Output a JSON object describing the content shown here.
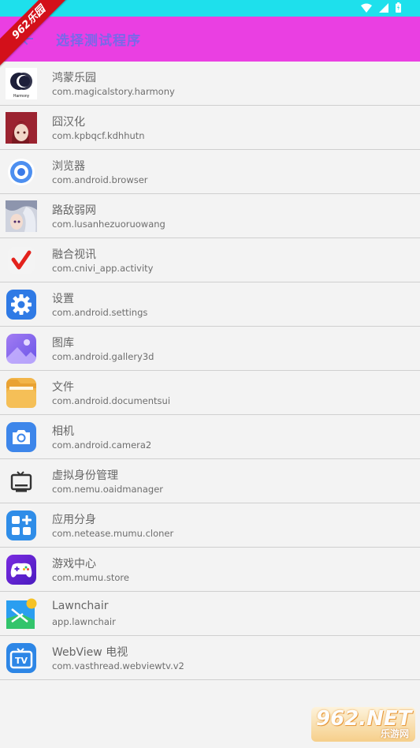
{
  "app_bar": {
    "title": "选择测试程序"
  },
  "ribbon": {
    "text": "962乐园"
  },
  "watermark": {
    "big": "962.NET",
    "small": "乐游网"
  },
  "apps": [
    {
      "name": "鸿蒙乐园",
      "package": "com.magicalstory.harmony",
      "icon": "harmony-icon",
      "icon_label": "Harmony"
    },
    {
      "name": "囧汉化",
      "package": "com.kpbqcf.kdhhutn",
      "icon": "anime-girl-icon"
    },
    {
      "name": "浏览器",
      "package": "com.android.browser",
      "icon": "browser-icon"
    },
    {
      "name": "路敌弱网",
      "package": "com.lusanhezuoruowang",
      "icon": "anime-character-icon"
    },
    {
      "name": "融合视讯",
      "package": "com.cnivi_app.activity",
      "icon": "checkmark-icon"
    },
    {
      "name": "设置",
      "package": "com.android.settings",
      "icon": "gear-icon"
    },
    {
      "name": "图库",
      "package": "com.android.gallery3d",
      "icon": "gallery-icon"
    },
    {
      "name": "文件",
      "package": "com.android.documentsui",
      "icon": "folder-icon"
    },
    {
      "name": "相机",
      "package": "com.android.camera2",
      "icon": "camera-icon"
    },
    {
      "name": "虚拟身份管理",
      "package": "com.nemu.oaidmanager",
      "icon": "tv-icon"
    },
    {
      "name": "应用分身",
      "package": "com.netease.mumu.cloner",
      "icon": "apps-plus-icon"
    },
    {
      "name": "游戏中心",
      "package": "com.mumu.store",
      "icon": "gamepad-icon"
    },
    {
      "name": "Lawnchair",
      "package": "app.lawnchair",
      "icon": "lawnchair-icon"
    },
    {
      "name": "WebView 电视",
      "package": "com.vasthread.webviewtv.v2",
      "icon": "webview-tv-icon"
    }
  ],
  "colors": {
    "status_bar": "#1ee0ec",
    "app_bar": "#ea3fe2",
    "title": "#7a67e9"
  }
}
